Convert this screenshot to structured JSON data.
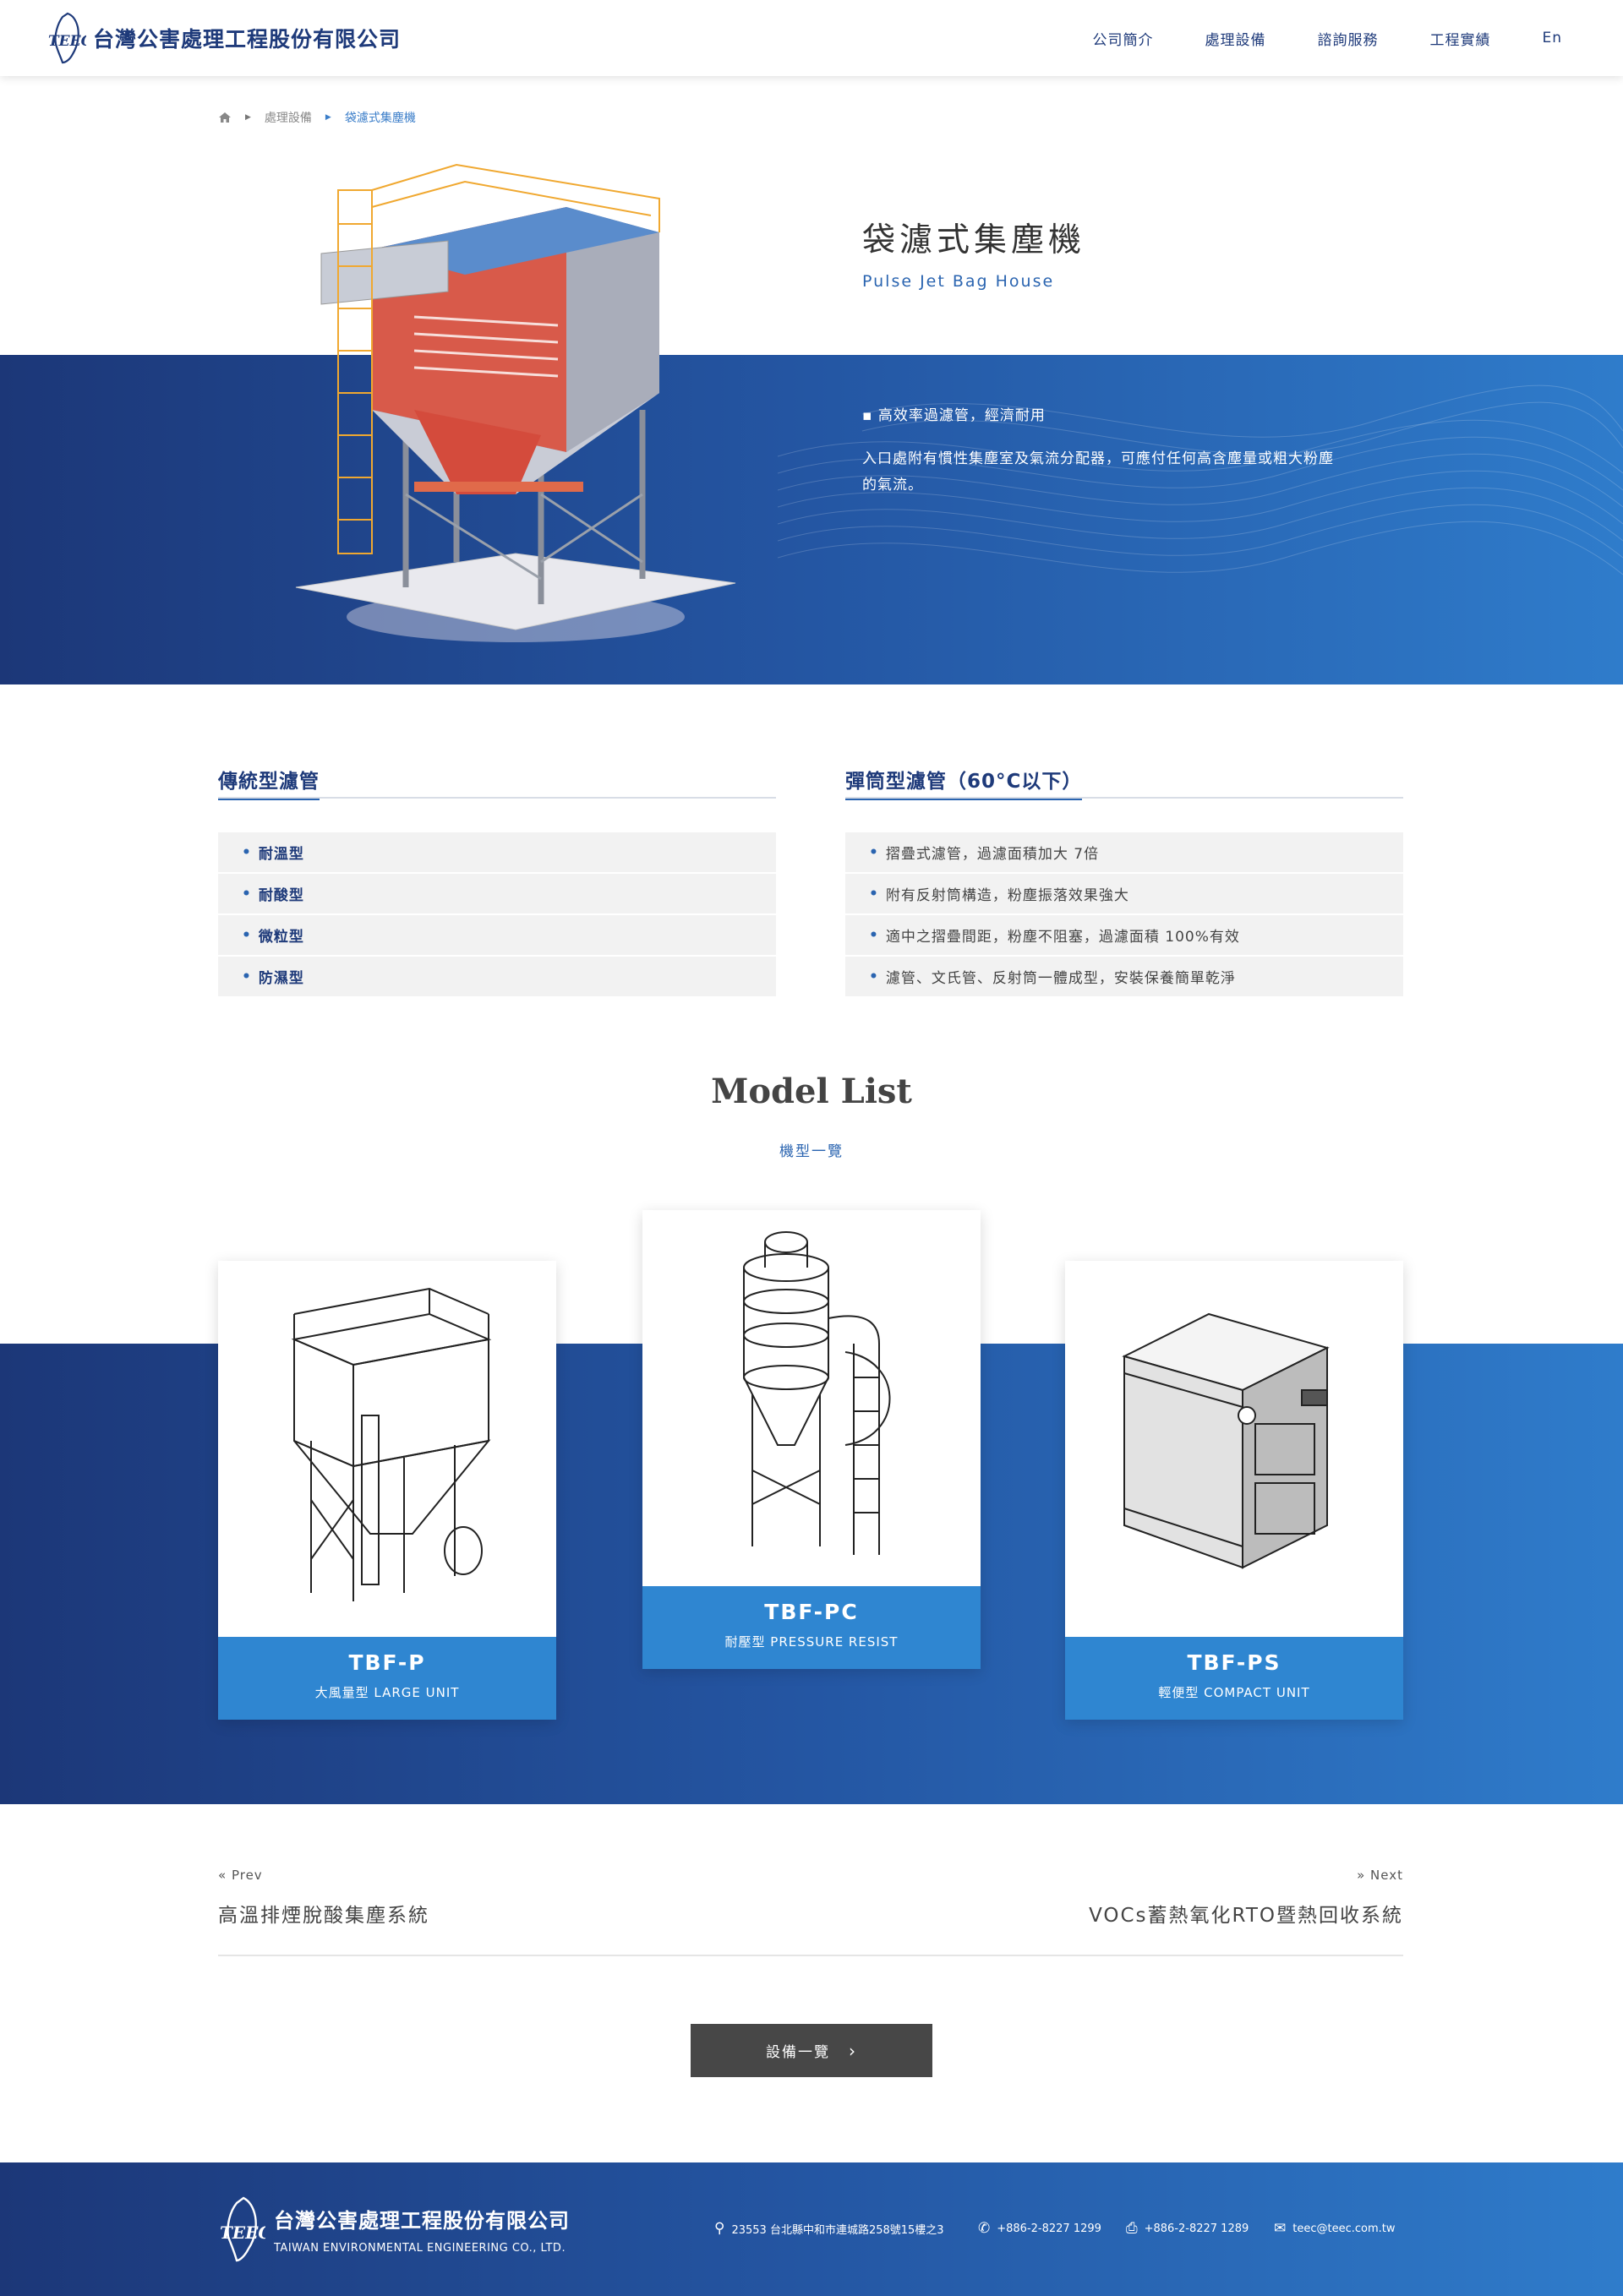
{
  "header": {
    "logo_text": "台灣公害處理工程股份有限公司",
    "nav": [
      "公司簡介",
      "處理設備",
      "諮詢服務",
      "工程實績",
      "En"
    ]
  },
  "breadcrumb": {
    "home_icon": "home-icon",
    "level1": "處理設備",
    "level2": "袋濾式集塵機"
  },
  "hero": {
    "title": "袋濾式集塵機",
    "subtitle": "Pulse Jet Bag House",
    "bullet": "▪ 高效率過濾管，經濟耐用",
    "description": "入口處附有慣性集塵室及氣流分配器，可應付任何高含塵量或粗大粉塵的氣流。"
  },
  "filters": {
    "left": {
      "title": "傳統型濾管",
      "items": [
        "耐溫型",
        "耐酸型",
        "微粒型",
        "防濕型"
      ]
    },
    "right": {
      "title": "彈筒型濾管（60°C以下）",
      "items": [
        "摺疊式濾管，過濾面積加大 7倍",
        "附有反射筒構造，粉塵振落效果強大",
        "適中之摺疊間距，粉塵不阻塞，過濾面積 100%有效",
        "濾管、文氏管、反射筒一體成型，安裝保養簡單乾淨"
      ]
    }
  },
  "models": {
    "title": "Model List",
    "subtitle": "機型一覽",
    "cards": [
      {
        "name": "TBF-P",
        "desc": "大風量型 LARGE UNIT"
      },
      {
        "name": "TBF-PC",
        "desc": "耐壓型 PRESSURE RESIST"
      },
      {
        "name": "TBF-PS",
        "desc": "輕便型 COMPACT UNIT"
      }
    ]
  },
  "pager": {
    "prev_label": "Prev",
    "prev_title": "高溫排煙脫酸集塵系統",
    "next_label": "Next",
    "next_title": "VOCs蓄熱氧化RTO暨熱回收系統"
  },
  "all_button": "設備一覽",
  "footer": {
    "logo_cn": "台灣公害處理工程股份有限公司",
    "logo_en": "TAIWAN ENVIRONMENTAL ENGINEERING CO., LTD.",
    "address": "23553 台北縣中和市連城路258號15樓之3",
    "phone": "+886-2-8227 1299",
    "fax": "+886-2-8227 1289",
    "email": "teec@teec.com.tw"
  },
  "colors": {
    "navy": "#1e3a7a",
    "blue": "#2a64b0",
    "caption": "#2f86d1",
    "button": "#474747"
  }
}
